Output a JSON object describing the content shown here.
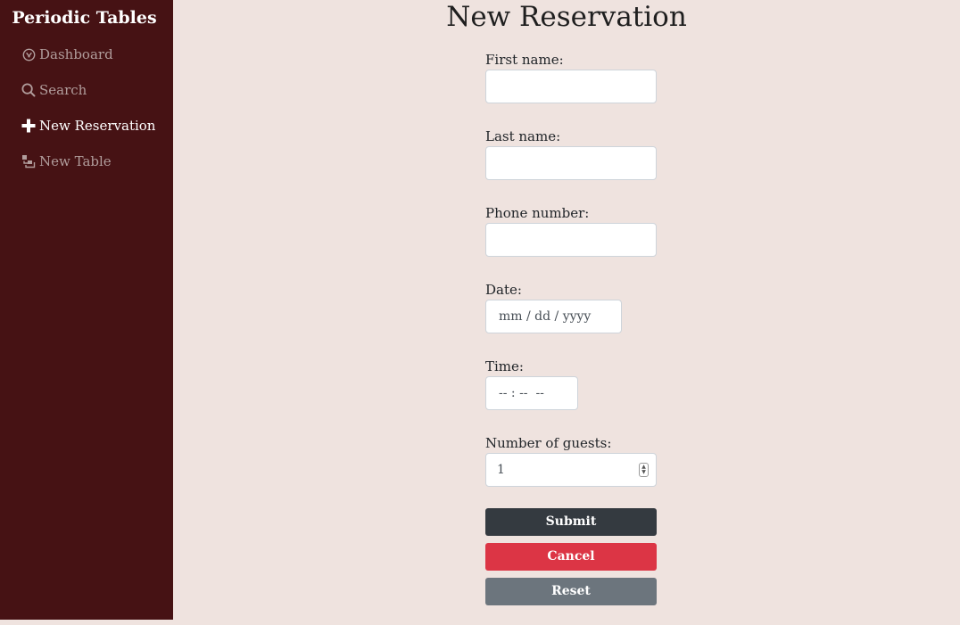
{
  "sidebar": {
    "brand": "Periodic Tables",
    "items": [
      {
        "label": "Dashboard",
        "icon": "dashboard-icon",
        "active": false
      },
      {
        "label": "Search",
        "icon": "search-icon",
        "active": false
      },
      {
        "label": "New Reservation",
        "icon": "plus-icon",
        "active": true
      },
      {
        "label": "New Table",
        "icon": "layers-icon",
        "active": false
      }
    ]
  },
  "main": {
    "title": "New Reservation",
    "form": {
      "first_name": {
        "label": "First name:",
        "value": ""
      },
      "last_name": {
        "label": "Last name:",
        "value": ""
      },
      "phone": {
        "label": "Phone number:",
        "value": ""
      },
      "date": {
        "label": "Date:",
        "placeholder": "mm / dd / yyyy"
      },
      "time": {
        "label": "Time:",
        "placeholder": "-- : --  --"
      },
      "people": {
        "label": "Number of guests:",
        "value": "1"
      }
    },
    "buttons": {
      "submit": "Submit",
      "cancel": "Cancel",
      "reset": "Reset"
    }
  },
  "colors": {
    "sidebar_bg": "#461214",
    "page_bg": "#efe3df",
    "submit": "#343a40",
    "cancel": "#dc3545",
    "reset": "#6c757d"
  }
}
